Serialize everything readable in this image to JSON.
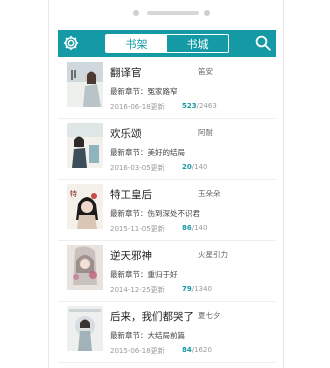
{
  "header": {
    "tabs": [
      {
        "label": "书架"
      },
      {
        "label": "书城"
      }
    ]
  },
  "books": [
    {
      "title": "翻译官",
      "author": "笛安",
      "chapter_prefix": "最新章节：",
      "chapter": "冤家路窄",
      "date": "2016-06-18更新",
      "read": "523",
      "total": "/2463"
    },
    {
      "title": "欢乐颂",
      "author": "阿耐",
      "chapter_prefix": "最新章节：",
      "chapter": "美好的结局",
      "date": "2016-03-05更新",
      "read": "20",
      "total": "/140"
    },
    {
      "title": "特工皇后",
      "author": "玉朵朵",
      "chapter_prefix": "最新章节：",
      "chapter": "伤到深处不识君",
      "date": "2015-11-05更新",
      "read": "86",
      "total": "/140"
    },
    {
      "title": "逆天邪神",
      "author": "火星引力",
      "chapter_prefix": "最新章节：",
      "chapter": "重归于好",
      "date": "2014-12-25更新",
      "read": "79",
      "total": "/1340"
    },
    {
      "title": "后来，我们都哭了",
      "author": "夏七夕",
      "chapter_prefix": "最新章节：",
      "chapter": "大结局前篇",
      "date": "2015-06-18更新",
      "read": "84",
      "total": "/1620"
    }
  ],
  "colors": {
    "accent": "#139aa5"
  },
  "icons": {
    "left": "gear-icon",
    "right": "search-icon"
  }
}
